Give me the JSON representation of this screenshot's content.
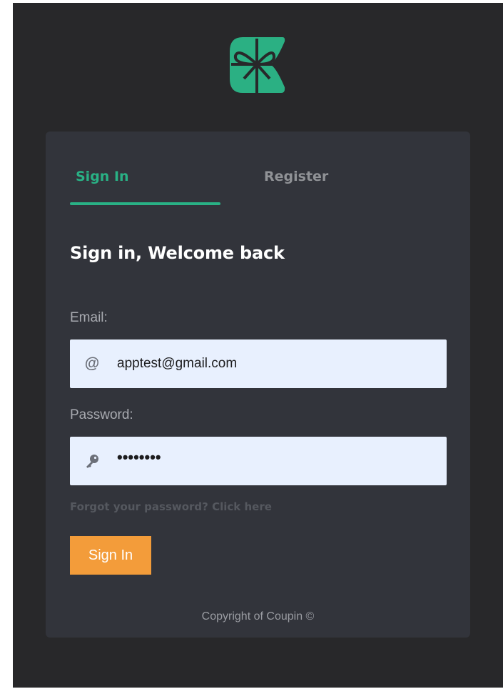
{
  "brand": {
    "logo_icon": "coupin-gift-logo",
    "accent_color": "#29b185"
  },
  "tabs": [
    {
      "label": "Sign In",
      "active": true
    },
    {
      "label": "Register",
      "active": false
    }
  ],
  "form": {
    "heading": "Sign in, Welcome back",
    "email": {
      "label": "Email:",
      "icon": "at-sign-icon",
      "value": "apptest@gmail.com"
    },
    "password": {
      "label": "Password:",
      "icon": "key-icon",
      "masked_value": "••••••••"
    },
    "forgot_link": "Forgot your password? Click here",
    "submit_label": "Sign In",
    "submit_color": "#f39c3a"
  },
  "footer": {
    "copyright": "Copyright of Coupin ©"
  }
}
